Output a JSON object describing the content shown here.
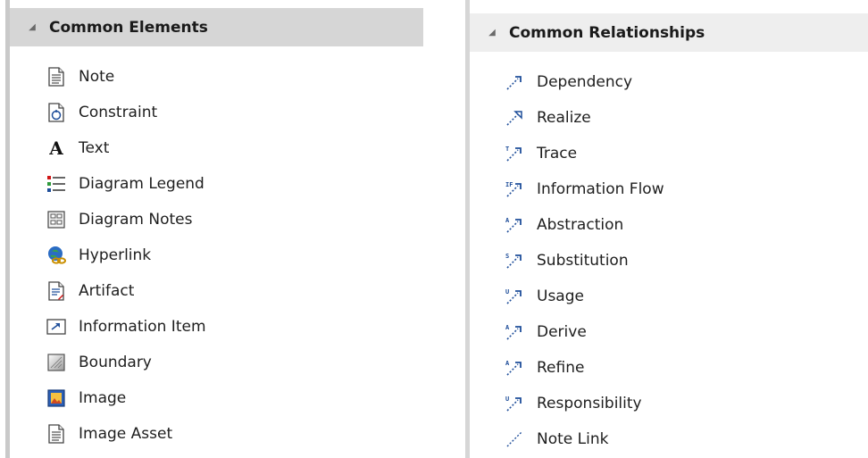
{
  "left": {
    "header": "Common Elements",
    "items": [
      {
        "label": "Note",
        "icon": "note-icon"
      },
      {
        "label": "Constraint",
        "icon": "constraint-icon"
      },
      {
        "label": "Text",
        "icon": "text-icon"
      },
      {
        "label": "Diagram Legend",
        "icon": "diagram-legend-icon"
      },
      {
        "label": "Diagram Notes",
        "icon": "diagram-notes-icon"
      },
      {
        "label": "Hyperlink",
        "icon": "hyperlink-icon"
      },
      {
        "label": "Artifact",
        "icon": "artifact-icon"
      },
      {
        "label": "Information Item",
        "icon": "information-item-icon"
      },
      {
        "label": "Boundary",
        "icon": "boundary-icon"
      },
      {
        "label": "Image",
        "icon": "image-icon"
      },
      {
        "label": "Image Asset",
        "icon": "image-asset-icon"
      }
    ]
  },
  "right": {
    "header": "Common Relationships",
    "items": [
      {
        "label": "Dependency",
        "icon": "dependency-icon"
      },
      {
        "label": "Realize",
        "icon": "realize-icon"
      },
      {
        "label": "Trace",
        "icon": "trace-icon"
      },
      {
        "label": "Information Flow",
        "icon": "information-flow-icon"
      },
      {
        "label": "Abstraction",
        "icon": "abstraction-icon"
      },
      {
        "label": "Substitution",
        "icon": "substitution-icon"
      },
      {
        "label": "Usage",
        "icon": "usage-icon"
      },
      {
        "label": "Derive",
        "icon": "derive-icon"
      },
      {
        "label": "Refine",
        "icon": "refine-icon"
      },
      {
        "label": "Responsibility",
        "icon": "responsibility-icon"
      },
      {
        "label": "Note Link",
        "icon": "note-link-icon"
      }
    ]
  },
  "relationship_tags": [
    "",
    "",
    "T",
    "IF",
    "A",
    "S",
    "U",
    "A",
    "A",
    "U",
    ""
  ],
  "colors": {
    "header_bg": "#d6d6d6",
    "accent_blue": "#1f4e9a",
    "accent_red": "#d01515",
    "accent_green": "#2f9a3d"
  }
}
